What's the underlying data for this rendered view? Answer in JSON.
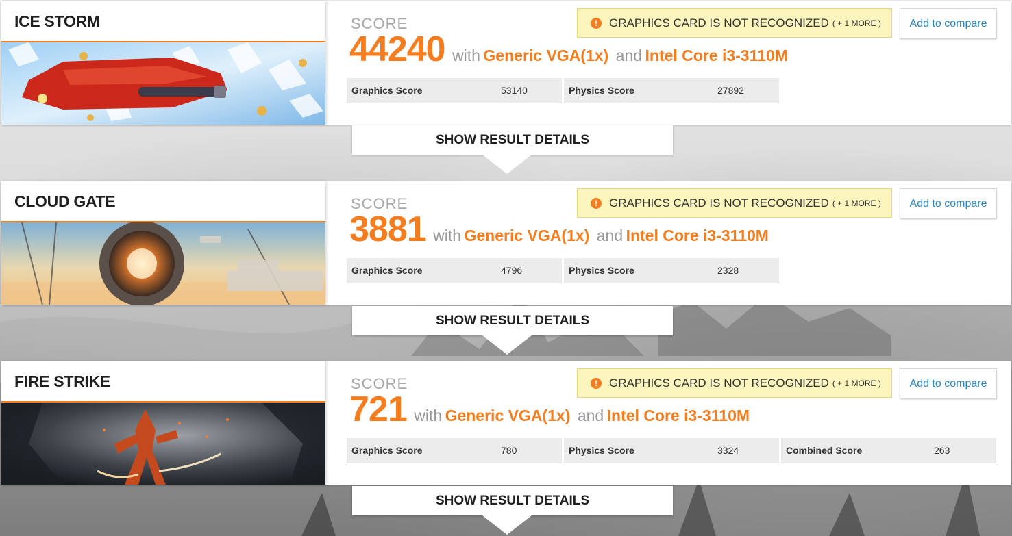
{
  "common": {
    "score_label": "SCORE",
    "with_text": "with",
    "and_text": "and",
    "gpu": "Generic VGA(1x)",
    "cpu": "Intel Core i3-3110M",
    "warning_text": "GRAPHICS CARD IS NOT RECOGNIZED",
    "warning_more": "( + 1 MORE )",
    "warning_icon": "!",
    "compare_label": "Add to compare",
    "details_label": "SHOW RESULT DETAILS"
  },
  "tests": [
    {
      "name": "ICE STORM",
      "score": "44240",
      "subscores": [
        {
          "label": "Graphics Score",
          "value": "53140"
        },
        {
          "label": "Physics Score",
          "value": "27892"
        }
      ]
    },
    {
      "name": "CLOUD GATE",
      "score": "3881",
      "subscores": [
        {
          "label": "Graphics Score",
          "value": "4796"
        },
        {
          "label": "Physics Score",
          "value": "2328"
        }
      ]
    },
    {
      "name": "FIRE STRIKE",
      "score": "721",
      "subscores": [
        {
          "label": "Graphics Score",
          "value": "780"
        },
        {
          "label": "Physics Score",
          "value": "3324"
        },
        {
          "label": "Combined Score",
          "value": "263"
        }
      ]
    }
  ],
  "colors": {
    "accent": "#f47d20",
    "link": "#2a86c6",
    "warning_bg": "#fcf5bd"
  }
}
